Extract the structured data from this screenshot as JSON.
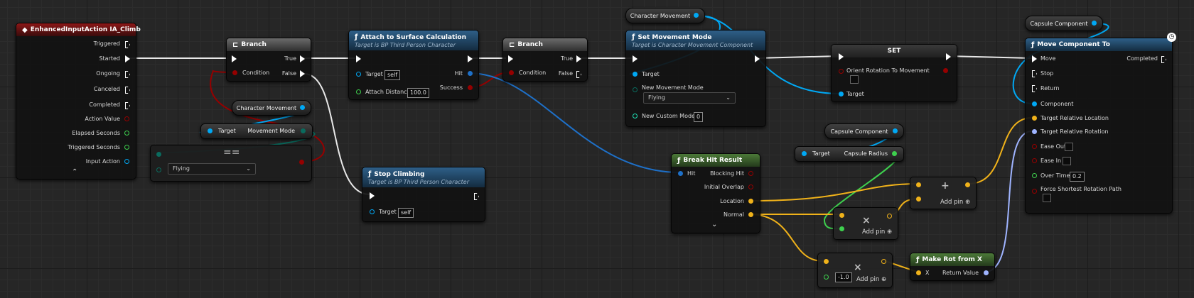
{
  "colors": {
    "exec": "#ffffff",
    "bool": "#950000",
    "object": "#00a8f4",
    "struct": "#f0b21a",
    "rotator": "#9fb4ff",
    "float": "#3ed04e",
    "enum": "#0a6b5e",
    "wire_exec": "#ffffff",
    "graph_bg": "#262626"
  },
  "input_event": {
    "title": "EnhancedInputAction IA_Climb",
    "icon": "input-action-icon",
    "outputs": [
      "Triggered",
      "Started",
      "Ongoing",
      "Canceled",
      "Completed",
      "Action Value",
      "Elapsed Seconds",
      "Triggered Seconds",
      "Input Action"
    ]
  },
  "branch1": {
    "title": "Branch",
    "icon": "branch-icon",
    "condition": "Condition",
    "true_label": "True",
    "false_label": "False"
  },
  "var_char_move_1": {
    "label": "Character Movement"
  },
  "get_movement_mode": {
    "target": "Target",
    "output": "Movement Mode"
  },
  "equal_enum": {
    "value": "Flying",
    "symbol": "=="
  },
  "attach_calc": {
    "title": "Attach to Surface Calculation",
    "subtitle": "Target is BP Third Person Character",
    "target": "Target",
    "target_value": "self",
    "attach_distance": "Attach Distance",
    "attach_distance_value": "100.0",
    "hit": "Hit",
    "success": "Success"
  },
  "branch2": {
    "title": "Branch",
    "condition": "Condition",
    "true_label": "True",
    "false_label": "False"
  },
  "stop_climbing": {
    "title": "Stop Climbing",
    "subtitle": "Target is BP Third Person Character",
    "target": "Target",
    "target_value": "self"
  },
  "var_char_move_2": {
    "label": "Character Movement"
  },
  "set_movement_mode": {
    "title": "Set Movement Mode",
    "subtitle": "Target is Character Movement Component",
    "target": "Target",
    "new_movement_mode": "New Movement Mode",
    "new_movement_mode_value": "Flying",
    "new_custom_mode": "New Custom Mode",
    "new_custom_mode_value": "0"
  },
  "set_node": {
    "title": "SET",
    "orient": "Orient Rotation To Movement",
    "target": "Target"
  },
  "break_hit": {
    "title": "Break Hit Result",
    "hit": "Hit",
    "outputs": [
      "Blocking Hit",
      "Initial Overlap",
      "Location",
      "Normal"
    ]
  },
  "var_capsule_1": {
    "label": "Capsule Component"
  },
  "get_capsule_radius": {
    "target": "Target",
    "output": "Capsule Radius"
  },
  "multiply1": {
    "symbol": "×",
    "add_pin": "Add pin"
  },
  "add_node": {
    "symbol": "+",
    "add_pin": "Add pin"
  },
  "multiply2": {
    "symbol": "×",
    "add_pin": "Add pin",
    "value": "-1.0"
  },
  "make_rot": {
    "title": "Make Rot from X",
    "x": "X",
    "return_value": "Return Value"
  },
  "var_capsule_2": {
    "label": "Capsule Component"
  },
  "move_component": {
    "title": "Move Component To",
    "inputs": [
      "Move",
      "Stop",
      "Return",
      "Component",
      "Target Relative Location",
      "Target Relative Rotation",
      "Ease Out",
      "Ease In",
      "Over Time",
      "Force Shortest Rotation Path"
    ],
    "completed": "Completed",
    "over_time_value": "0.2"
  }
}
